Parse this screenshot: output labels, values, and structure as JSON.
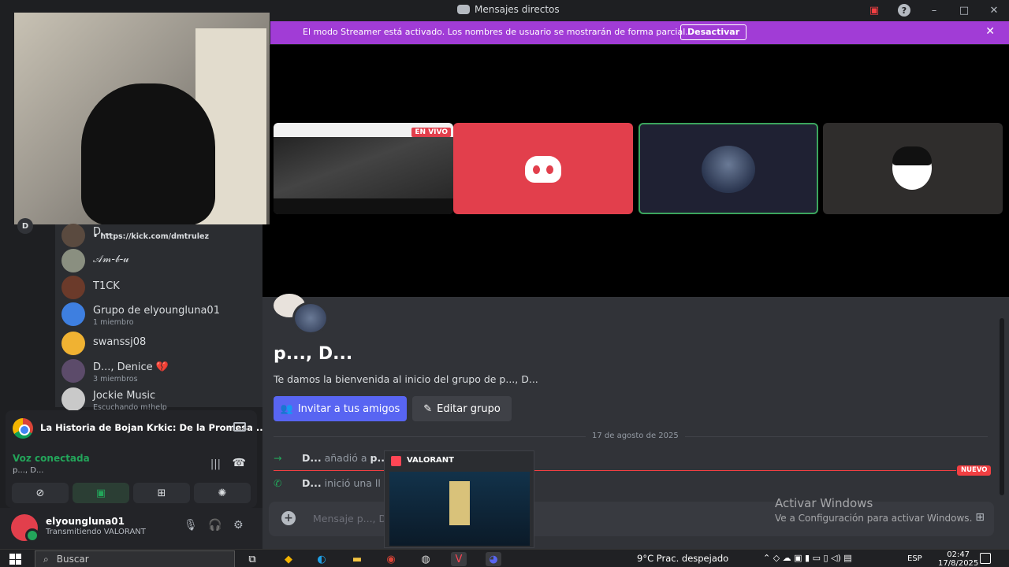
{
  "window": {
    "title": "Mensajes directos",
    "controls": {
      "minimize": "–",
      "maximize": "□",
      "close": "✕"
    }
  },
  "banner": {
    "text": "El modo Streamer está activado. Los nombres de usuario se mostrarán de forma parcial.",
    "button": "Desactivar",
    "close": "✕"
  },
  "call": {
    "live_badge": "EN VIVO"
  },
  "server_rail": {
    "icon_letter": "D"
  },
  "dm_list": {
    "kick_link": "• https://kick.com/dmtrulez",
    "items": [
      {
        "name": "D...",
        "sub": ""
      },
      {
        "name": "𝒜𝓂-𝒷-𝓊",
        "sub": ""
      },
      {
        "name": "T1CK",
        "sub": ""
      },
      {
        "name": "Grupo de elyoungluna01",
        "sub": "1 miembro"
      },
      {
        "name": "swanssj08",
        "sub": ""
      },
      {
        "name": "D..., Denice 💔",
        "sub": "3 miembros"
      },
      {
        "name": "Jockie Music",
        "sub": "Escuchando m!help"
      }
    ]
  },
  "now_playing": {
    "label": "La Historia de Bojan Krkic: De la Promesa ..."
  },
  "voice": {
    "status": "Voz conectada",
    "channel": "p..., D..."
  },
  "user": {
    "name": "elyoungluna01",
    "status": "Transmitiendo VALORANT"
  },
  "chat": {
    "group_title": "p..., D...",
    "welcome": "Te damos la bienvenida al inicio del grupo de p..., D...",
    "invite_button": "Invitar a tus amigos",
    "edit_button": "Editar grupo",
    "date": "17 de agosto de 2025",
    "messages": [
      {
        "actor": "D...",
        "text": " añadió a ",
        "target": "p..."
      },
      {
        "actor": "D...",
        "text": " inició una ll",
        "target": ""
      }
    ],
    "new_badge": "NUEVO",
    "input_placeholder": "Mensaje p..., D"
  },
  "watermark": {
    "line1": "Activar Windows",
    "line2": "Ve a Configuración para activar Windows."
  },
  "valorant_popup": {
    "title": "VALORANT"
  },
  "taskbar": {
    "search_placeholder": "Buscar",
    "weather": "9°C  Prac. despejado",
    "lang": "ESP",
    "time": "02:47",
    "date": "17/8/2025"
  }
}
